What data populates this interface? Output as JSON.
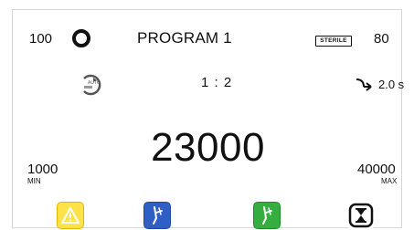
{
  "header": {
    "torque_value": "100",
    "program_title": "PROGRAM 1",
    "sterile_label": "STERILE",
    "sterile_value": "80"
  },
  "settings": {
    "ratio": "1 : 2",
    "delay": "2.0 s",
    "auto_label": "AUTO"
  },
  "speed": {
    "current": "23000",
    "min_value": "1000",
    "min_label": "MIN",
    "max_value": "40000",
    "max_label": "MAX"
  },
  "buttons": {
    "warning_icon": "warning-triangle-icon",
    "blue_icon": "contra-angle-handpiece-icon",
    "green_icon": "contra-angle-handpiece-icon",
    "timer_icon": "hourglass-icon"
  },
  "colors": {
    "warning": "#ffe14a",
    "blue": "#2f5fc4",
    "green": "#35ad3f",
    "text": "#111111"
  }
}
